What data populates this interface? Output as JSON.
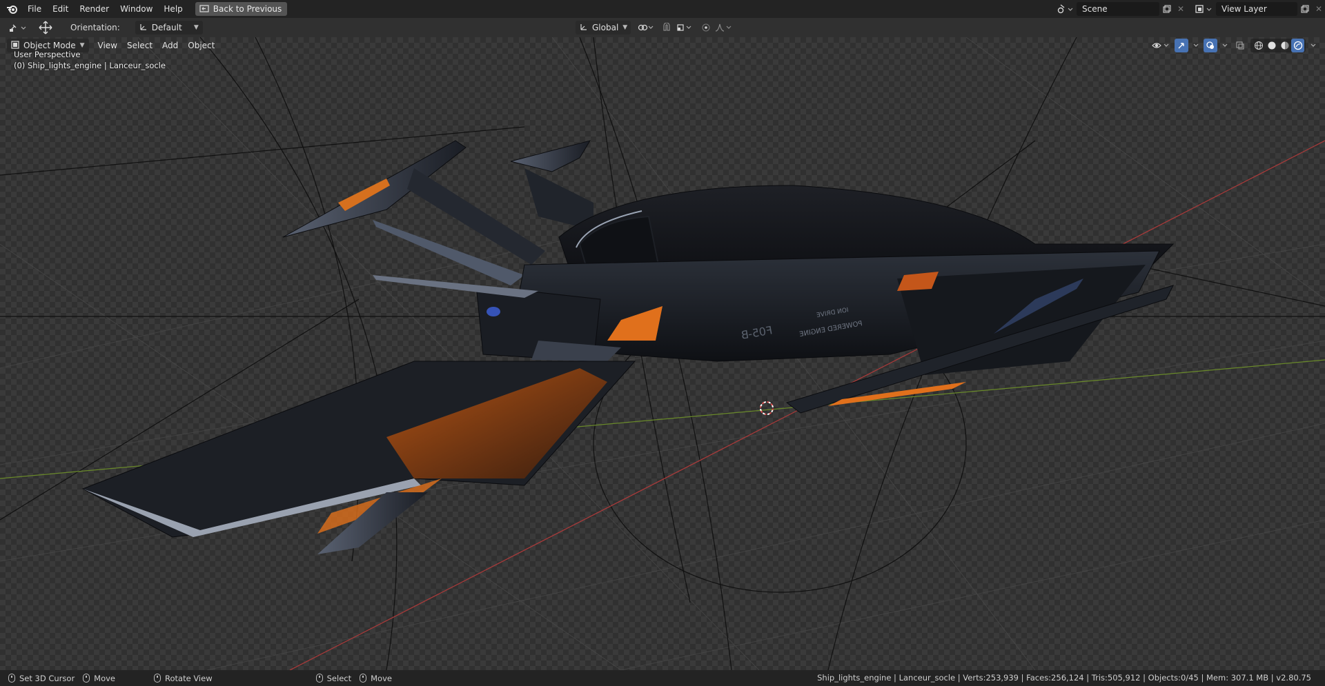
{
  "topbar": {
    "menus": [
      "File",
      "Edit",
      "Render",
      "Window",
      "Help"
    ],
    "back_button": "Back to Previous",
    "scene_name": "Scene",
    "view_layer_name": "View Layer"
  },
  "header": {
    "orientation_label": "Orientation:",
    "orientation_value": "Default",
    "transform_space": "Global"
  },
  "viewport": {
    "mode": "Object Mode",
    "menus": [
      "View",
      "Select",
      "Add",
      "Object"
    ],
    "perspective": "User Perspective",
    "active_object": "(0) Ship_lights_engine | Lanceur_socle",
    "hull_text": [
      "ION DRIVE",
      "POWERED ENGINE",
      "F05-B"
    ]
  },
  "statusbar": {
    "items": [
      "Set 3D Cursor",
      "Move",
      "Rotate View",
      "Select",
      "Move"
    ],
    "stats": "Ship_lights_engine | Lanceur_socle | Verts:253,939 | Faces:256,124 | Tris:505,912 | Objects:0/45 | Mem: 307.1 MB | v2.80.75"
  },
  "colors": {
    "accent_orange": "#e0701c",
    "x_axis_red": "#a83a3a",
    "y_axis_green": "#6a8a2a",
    "button_active_blue": "#4772b3"
  },
  "icons": [
    "blender-logo-icon",
    "back-arrow-icon",
    "scene-icon",
    "view-layer-icon",
    "copy-icon",
    "close-icon",
    "editor-type-icon",
    "move-tool-icon",
    "orientation-axes-icon",
    "pivot-icon",
    "snap-icon",
    "proportional-edit-icon",
    "visibility-icon",
    "gizmo-icon",
    "overlay-icon",
    "xray-icon",
    "wireframe-shading-icon",
    "solid-shading-icon",
    "material-shading-icon",
    "rendered-shading-icon",
    "3d-cursor-icon",
    "mouse-left-icon",
    "mouse-middle-icon",
    "mouse-right-icon"
  ]
}
